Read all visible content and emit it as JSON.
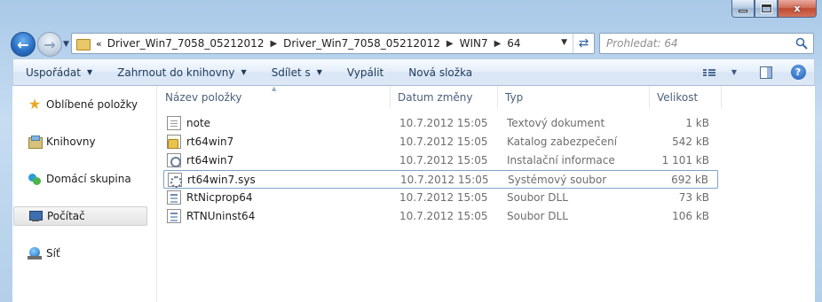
{
  "window": {
    "minimize_label": "",
    "maximize_label": "",
    "close_label": "x"
  },
  "address": {
    "lead": "«",
    "crumbs": [
      "Driver_Win7_7058_05212012",
      "Driver_Win7_7058_05212012",
      "WIN7",
      "64"
    ]
  },
  "search": {
    "placeholder": "Prohledat: 64"
  },
  "toolbar": {
    "organize": "Uspořádat",
    "include_library": "Zahrnout do knihovny",
    "share": "Sdílet s",
    "burn": "Vypálit",
    "new_folder": "Nová složka"
  },
  "nav": {
    "favorites": "Oblíbené položky",
    "libraries": "Knihovny",
    "homegroup": "Domácí skupina",
    "computer": "Počítač",
    "network": "Síť"
  },
  "columns": {
    "name": "Název položky",
    "date": "Datum změny",
    "type": "Typ",
    "size": "Velikost"
  },
  "files": [
    {
      "name": "note",
      "date": "10.7.2012 15:05",
      "type": "Textový dokument",
      "size": "1 kB",
      "icon": "text-file-icon"
    },
    {
      "name": "rt64win7",
      "date": "10.7.2012 15:05",
      "type": "Katalog zabezpečení",
      "size": "542 kB",
      "icon": "security-catalog-icon"
    },
    {
      "name": "rt64win7",
      "date": "10.7.2012 15:05",
      "type": "Instalační informace",
      "size": "1 101 kB",
      "icon": "setup-info-icon"
    },
    {
      "name": "rt64win7.sys",
      "date": "10.7.2012 15:05",
      "type": "Systémový soubor",
      "size": "692 kB",
      "icon": "system-file-icon"
    },
    {
      "name": "RtNicprop64",
      "date": "10.7.2012 15:05",
      "type": "Soubor DLL",
      "size": "73 kB",
      "icon": "dll-file-icon"
    },
    {
      "name": "RTNUninst64",
      "date": "10.7.2012 15:05",
      "type": "Soubor DLL",
      "size": "106 kB",
      "icon": "dll-file-icon"
    }
  ],
  "colors": {
    "frame": "#b3cfe9",
    "toolbar_text": "#1e395b",
    "header_text": "#4c607a",
    "secondary_text": "#6d6d6d",
    "focus_border": "#7da2ce"
  }
}
